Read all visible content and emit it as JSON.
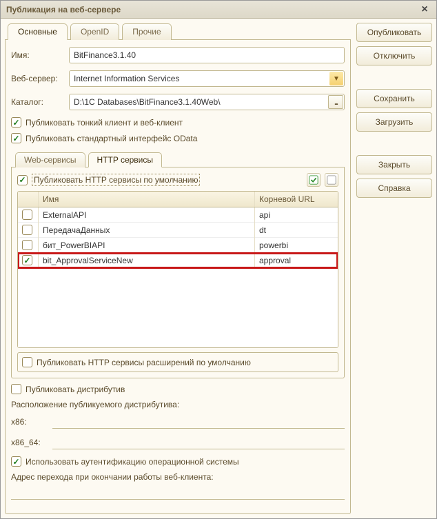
{
  "titlebar": {
    "title": "Публикация на веб-сервере"
  },
  "right_buttons": {
    "publish": "Опубликовать",
    "disconnect": "Отключить",
    "save": "Сохранить",
    "load": "Загрузить",
    "close": "Закрыть",
    "help": "Справка"
  },
  "main_tabs": [
    {
      "label": "Основные",
      "active": true
    },
    {
      "label": "OpenID",
      "active": false
    },
    {
      "label": "Прочие",
      "active": false
    }
  ],
  "form": {
    "name_label": "Имя:",
    "name_value": "BitFinance3.1.40",
    "webserver_label": "Веб-сервер:",
    "webserver_value": "Internet Information Services",
    "catalog_label": "Каталог:",
    "catalog_value": "D:\\1C Databases\\BitFinance3.1.40Web\\"
  },
  "checks": {
    "thin_client": {
      "label": "Публиковать тонкий клиент и веб-клиент",
      "checked": true
    },
    "odata": {
      "label": "Публиковать стандартный интерфейс OData",
      "checked": true
    }
  },
  "inner_tabs": [
    {
      "label": "Web-сервисы",
      "active": false
    },
    {
      "label": "HTTP сервисы",
      "active": true
    }
  ],
  "http_services": {
    "default_label": "Публиковать HTTP сервисы по умолчанию",
    "default_checked": true,
    "columns": {
      "name": "Имя",
      "url": "Корневой URL"
    },
    "rows": [
      {
        "checked": false,
        "name": "ExternalAPI",
        "url": "api",
        "highlight": false
      },
      {
        "checked": false,
        "name": "ПередачаДанных",
        "url": "dt",
        "highlight": false
      },
      {
        "checked": false,
        "name": "бит_PowerBIAPI",
        "url": "powerbi",
        "highlight": false
      },
      {
        "checked": true,
        "name": "bit_ApprovalServiceNew",
        "url": "approval",
        "highlight": true
      }
    ],
    "ext_label": "Публиковать HTTP сервисы расширений по умолчанию",
    "ext_checked": false
  },
  "dist": {
    "publish_label": "Публиковать дистрибутив",
    "publish_checked": false,
    "location_label": "Расположение публикуемого дистрибутива:",
    "x86_label": "x86:",
    "x86_value": "",
    "x86_64_label": "x86_64:",
    "x86_64_value": ""
  },
  "os_auth": {
    "label": "Использовать аутентификацию операционной системы",
    "checked": true
  },
  "redirect": {
    "label": "Адрес перехода при окончании работы веб-клиента:",
    "value": ""
  }
}
